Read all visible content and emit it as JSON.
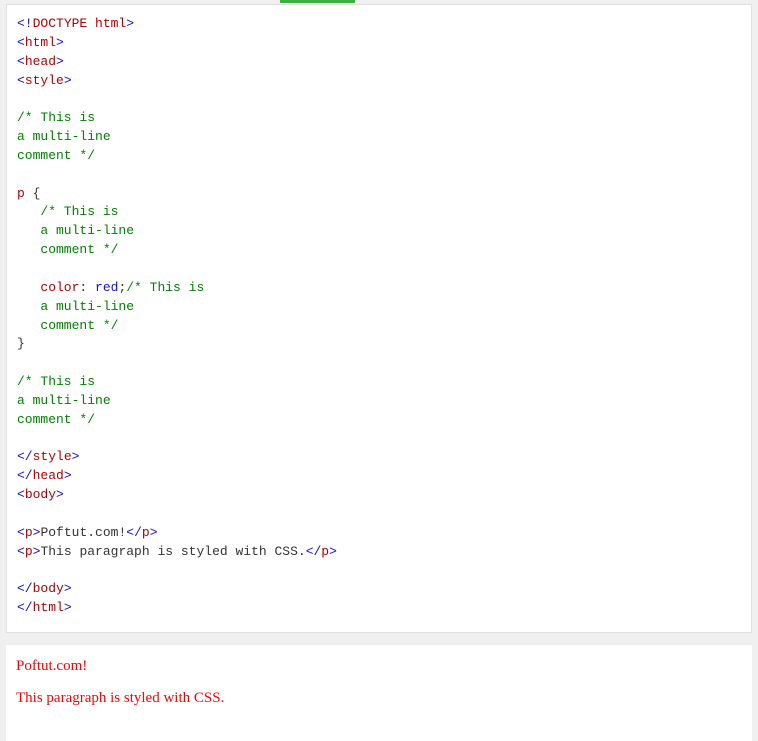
{
  "code": {
    "l1_lt": "<!",
    "l1_tag": "DOCTYPE",
    "l1_sp": " ",
    "l1_attr": "html",
    "l1_gt": ">",
    "l2_lt": "<",
    "l2_tag": "html",
    "l2_gt": ">",
    "l3_lt": "<",
    "l3_tag": "head",
    "l3_gt": ">",
    "l4_lt": "<",
    "l4_tag": "style",
    "l4_gt": ">",
    "c1_a": "/* This is",
    "c1_b": "a multi-line",
    "c1_c": "comment */",
    "sel_p": "p",
    "brace_open": " {",
    "c2_a": "   /* This is",
    "c2_b": "   a multi-line",
    "c2_c": "   comment */",
    "prop_indent": "   ",
    "prop": "color",
    "colon": ": ",
    "val": "red",
    "semi": ";",
    "c3_a": "/* This is",
    "c3_b": "   a multi-line",
    "c3_c": "   comment */",
    "brace_close": "}",
    "c4_a": "/* This is",
    "c4_b": "a multi-line",
    "c4_c": "comment */",
    "l5_lt": "</",
    "l5_tag": "style",
    "l5_gt": ">",
    "l6_lt": "</",
    "l6_tag": "head",
    "l6_gt": ">",
    "l7_lt": "<",
    "l7_tag": "body",
    "l7_gt": ">",
    "p1_lt": "<",
    "p1_tag": "p",
    "p1_gt": ">",
    "p1_text": "Poftut.com!",
    "p1_clt": "</",
    "p1_ctag": "p",
    "p1_cgt": ">",
    "p2_lt": "<",
    "p2_tag": "p",
    "p2_gt": ">",
    "p2_text": "This paragraph is styled with CSS.",
    "p2_clt": "</",
    "p2_ctag": "p",
    "p2_cgt": ">",
    "l8_lt": "</",
    "l8_tag": "body",
    "l8_gt": ">",
    "l9_lt": "</",
    "l9_tag": "html",
    "l9_gt": ">"
  },
  "output": {
    "p1": "Poftut.com!",
    "p2": "This paragraph is styled with CSS."
  }
}
